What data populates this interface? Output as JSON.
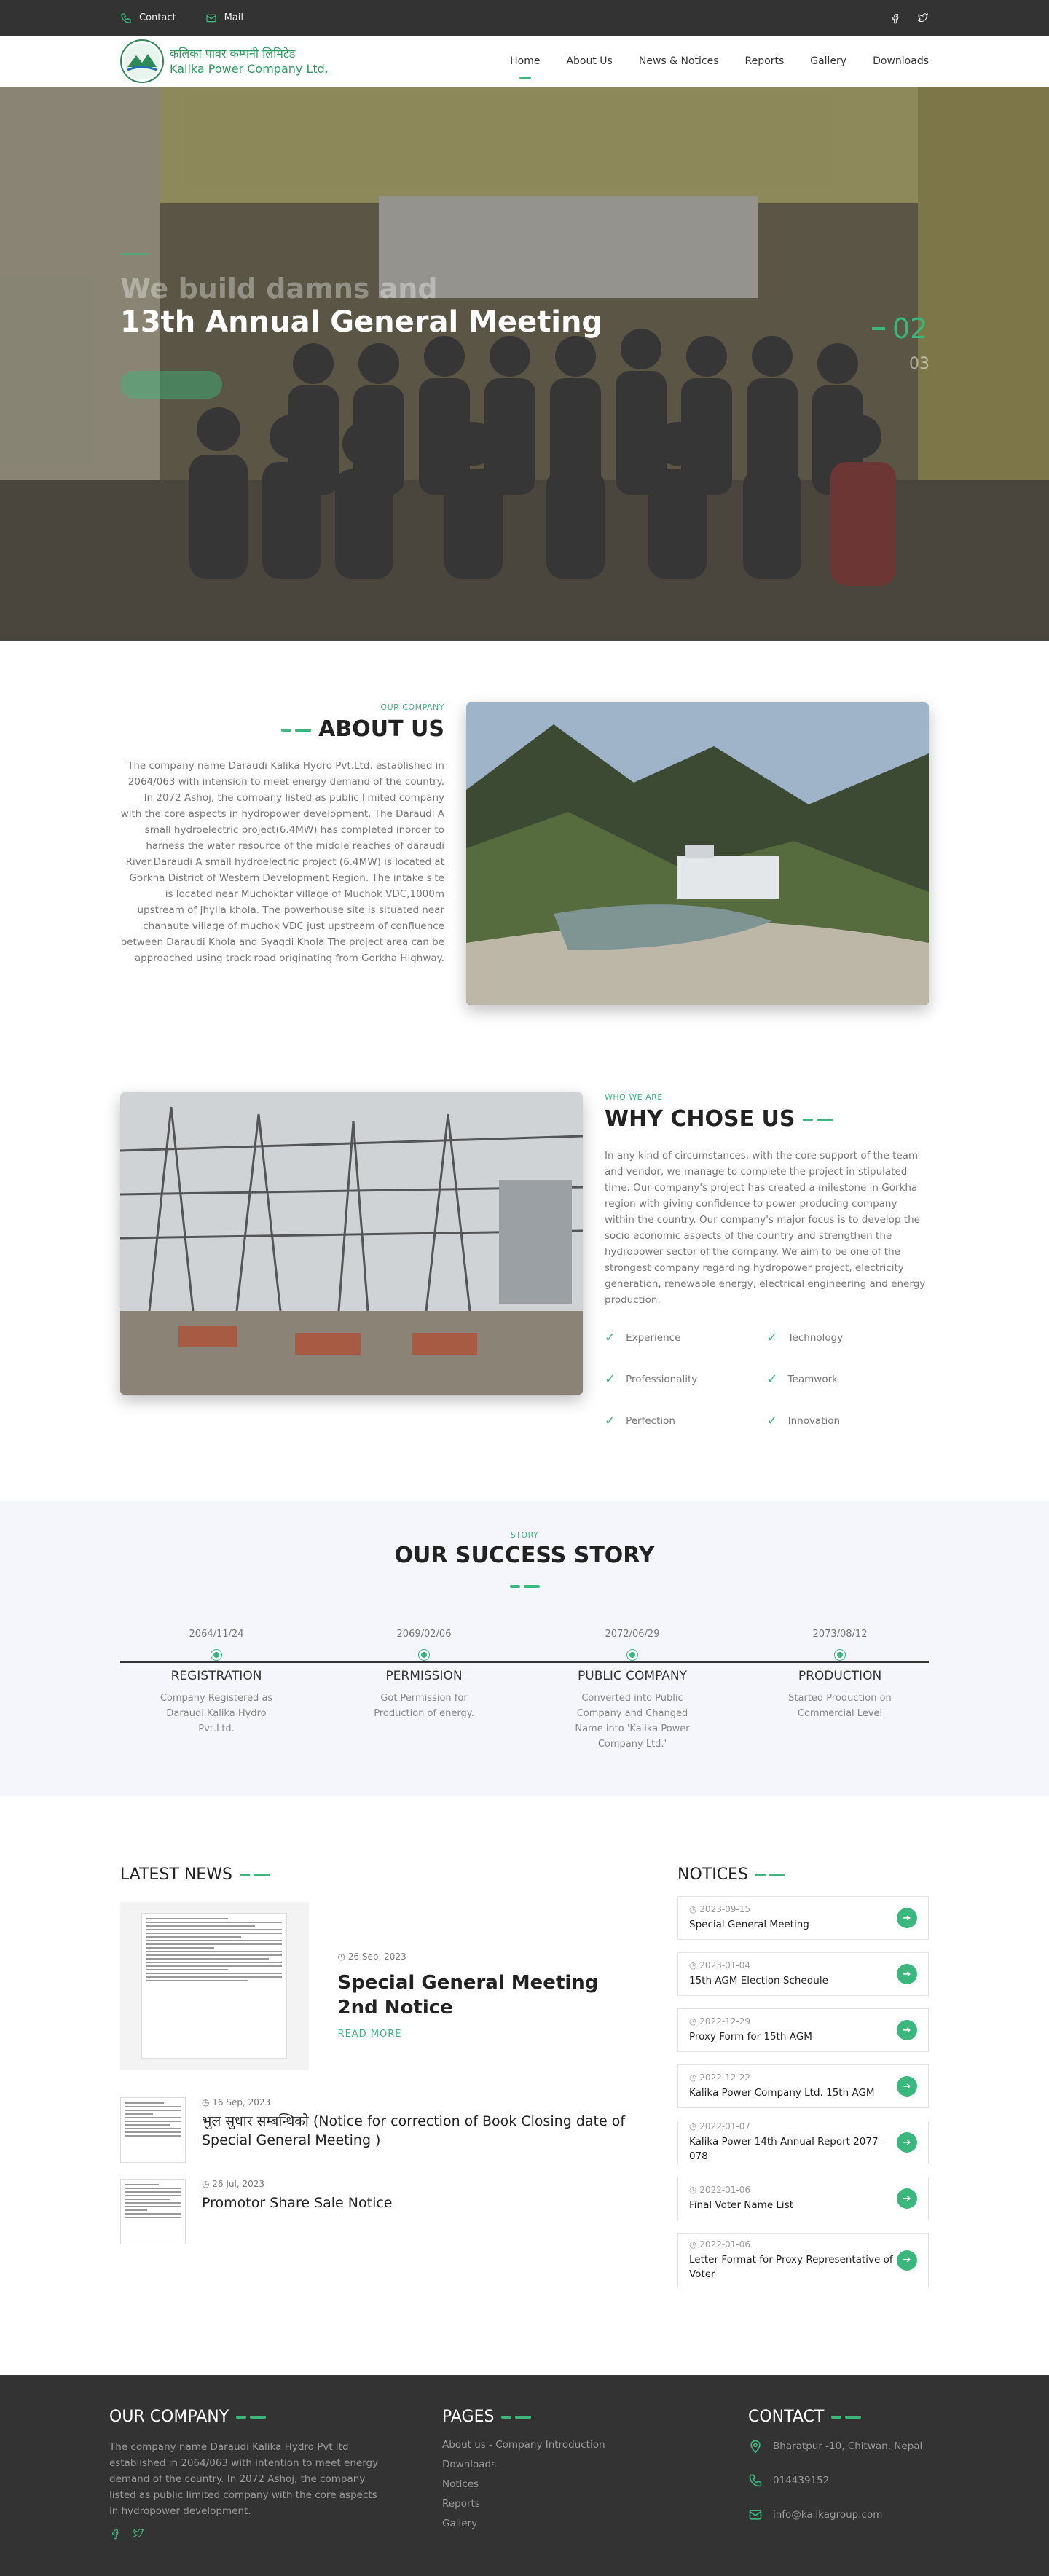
{
  "topbar": {
    "contact": "Contact",
    "mail": "Mail"
  },
  "nav": {
    "brand_np": "कलिका पावर कम्पनी लिमिटेड",
    "brand_en": "Kalika Power Company Ltd.",
    "items": [
      "Home",
      "About Us",
      "News & Notices",
      "Reports",
      "Gallery",
      "Downloads"
    ]
  },
  "hero": {
    "ghost": "We build damns and",
    "title": "13th Annual General Meeting",
    "slide": "02",
    "next": "03"
  },
  "about": {
    "eyebrow": "OUR COMPANY",
    "title": "ABOUT US",
    "text": "The company name Daraudi Kalika Hydro Pvt.Ltd. established in 2064/063 with intension to meet energy demand of the country. In 2072 Ashoj, the company listed as public limited company with the core aspects in hydropower development. The Daraudi A small hydroelectric project(6.4MW) has completed inorder to harness the water resource of the middle reaches of daraudi River.Daraudi A small hydroelectric project (6.4MW) is located at Gorkha District of Western Development Region. The intake site is located near Muchoktar village of Muchok VDC,1000m upstream of Jhylla khola. The powerhouse site is situated near chanaute village of muchok VDC just upstream of confluence between Daraudi Khola and Syagdi Khola.The project area can be approached using track road originating from Gorkha Highway."
  },
  "why": {
    "eyebrow": "WHO WE ARE",
    "title": "WHY CHOSE US",
    "text": "In any kind of circumstances, with the core support of the team and vendor, we manage to complete the project in stipulated time. Our company's project has created a milestone in Gorkha region with giving confidence to power producing company within the country. Our company's major focus is to develop the socio economic aspects of the country and strengthen the hydropower sector of the company. We aim to be one of the strongest company regarding hydropower project, electricity generation, renewable energy, electrical engineering and energy production.",
    "features": [
      "Experience",
      "Technology",
      "Professionality",
      "Teamwork",
      "Perfection",
      "Innovation"
    ]
  },
  "story": {
    "eyebrow": "STORY",
    "title": "OUR SUCCESS STORY",
    "events": [
      {
        "date": "2064/11/24",
        "head": "REGISTRATION",
        "desc": "Company Registered as Daraudi Kalika Hydro Pvt.Ltd."
      },
      {
        "date": "2069/02/06",
        "head": "PERMISSION",
        "desc": "Got Permission for Production of energy."
      },
      {
        "date": "2072/06/29",
        "head": "PUBLIC COMPANY",
        "desc": "Converted into Public Company and Changed Name into 'Kalika Power Company Ltd.'"
      },
      {
        "date": "2073/08/12",
        "head": "PRODUCTION",
        "desc": "Started Production on Commercial Level"
      }
    ]
  },
  "news": {
    "title": "LATEST NEWS",
    "featured": {
      "date": "26 Sep, 2023",
      "title": "Special General Meeting 2nd Notice",
      "more": "READ MORE"
    },
    "items": [
      {
        "date": "16 Sep, 2023",
        "title": "भुल सुधार सम्बन्धिको (Notice for correction of Book Closing date of Special General Meeting )"
      },
      {
        "date": "26 Jul, 2023",
        "title": "Promotor Share Sale Notice"
      }
    ]
  },
  "notices": {
    "title": "NOTICES",
    "items": [
      {
        "date": "2023-09-15",
        "title": "Special General Meeting"
      },
      {
        "date": "2023-01-04",
        "title": "15th AGM Election Schedule"
      },
      {
        "date": "2022-12-29",
        "title": "Proxy Form for 15th AGM"
      },
      {
        "date": "2022-12-22",
        "title": "Kalika Power Company Ltd. 15th AGM"
      },
      {
        "date": "2022-01-07",
        "title": "Kalika Power 14th Annual Report 2077-078"
      },
      {
        "date": "2022-01-06",
        "title": "Final Voter Name List"
      },
      {
        "date": "2022-01-06",
        "title": "Letter Format for Proxy Representative of Voter"
      }
    ]
  },
  "footer": {
    "company_title": "OUR COMPANY",
    "company_text": "The company name Daraudi Kalika Hydro Pvt ltd established in 2064/063 with intention to meet energy demand of the country. In 2072 Ashoj, the company listed as public limited company with the core aspects in hydropower development.",
    "pages_title": "PAGES",
    "pages": [
      "About us - Company Introduction",
      "Downloads",
      "Notices",
      "Reports",
      "Gallery"
    ],
    "contact_title": "CONTACT",
    "address": "Bharatpur -10, Chitwan, Nepal",
    "phone": "014439152",
    "email": "info@kalikagroup.com"
  }
}
